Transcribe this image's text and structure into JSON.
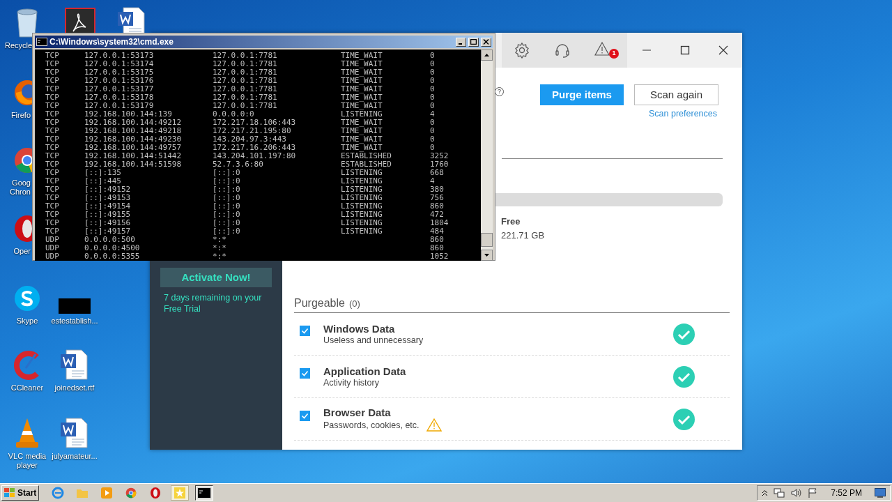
{
  "desktop_icons": [
    {
      "kind": "recycle",
      "label": "Recycle"
    },
    {
      "kind": "firefox",
      "label": "Firefo"
    },
    {
      "kind": "chrome",
      "label": "Goog\nChron"
    },
    {
      "kind": "opera",
      "label": "Oper"
    },
    {
      "kind": "skype",
      "label": "Skype"
    },
    {
      "kind": "ccleaner",
      "label": "CCleaner"
    },
    {
      "kind": "vlc",
      "label": "VLC media player"
    },
    {
      "kind": "pdf"
    },
    {
      "kind": "word"
    },
    {
      "kind": "blank",
      "label": "estestablish..."
    },
    {
      "kind": "word",
      "label": "joinedset.rtf"
    },
    {
      "kind": "word",
      "label": "julyamateur..."
    }
  ],
  "app": {
    "notification_count": "1",
    "help": "?",
    "purge_button": "Purge items",
    "scan_button": "Scan again",
    "scan_link": "Scan preferences",
    "free_label": "Free",
    "free_value": "221.71 GB",
    "activate_button": "Activate Now!",
    "trial_text": "7 days remaining on your Free Trial",
    "section_title": "Purgeable",
    "section_count": "(0)",
    "items": [
      {
        "title": "Windows Data",
        "subtitle": "Useless and unnecessary",
        "checked": true,
        "warning": false
      },
      {
        "title": "Application Data",
        "subtitle": "Activity history",
        "checked": true,
        "warning": false
      },
      {
        "title": "Browser Data",
        "subtitle": "Passwords, cookies, etc.",
        "checked": true,
        "warning": true
      }
    ]
  },
  "cmd": {
    "title": "C:\\Windows\\system32\\cmd.exe",
    "rows": [
      [
        "TCP",
        "127.0.0.1:53173",
        "127.0.0.1:7781",
        "TIME_WAIT",
        "0"
      ],
      [
        "TCP",
        "127.0.0.1:53174",
        "127.0.0.1:7781",
        "TIME_WAIT",
        "0"
      ],
      [
        "TCP",
        "127.0.0.1:53175",
        "127.0.0.1:7781",
        "TIME_WAIT",
        "0"
      ],
      [
        "TCP",
        "127.0.0.1:53176",
        "127.0.0.1:7781",
        "TIME_WAIT",
        "0"
      ],
      [
        "TCP",
        "127.0.0.1:53177",
        "127.0.0.1:7781",
        "TIME_WAIT",
        "0"
      ],
      [
        "TCP",
        "127.0.0.1:53178",
        "127.0.0.1:7781",
        "TIME_WAIT",
        "0"
      ],
      [
        "TCP",
        "127.0.0.1:53179",
        "127.0.0.1:7781",
        "TIME_WAIT",
        "0"
      ],
      [
        "TCP",
        "192.168.100.144:139",
        "0.0.0.0:0",
        "LISTENING",
        "4"
      ],
      [
        "TCP",
        "192.168.100.144:49212",
        "172.217.18.106:443",
        "TIME_WAIT",
        "0"
      ],
      [
        "TCP",
        "192.168.100.144:49218",
        "172.217.21.195:80",
        "TIME_WAIT",
        "0"
      ],
      [
        "TCP",
        "192.168.100.144:49230",
        "143.204.97.3:443",
        "TIME_WAIT",
        "0"
      ],
      [
        "TCP",
        "192.168.100.144:49757",
        "172.217.16.206:443",
        "TIME_WAIT",
        "0"
      ],
      [
        "TCP",
        "192.168.100.144:51442",
        "143.204.101.197:80",
        "ESTABLISHED",
        "3252"
      ],
      [
        "TCP",
        "192.168.100.144:51598",
        "52.7.3.6:80",
        "ESTABLISHED",
        "1760"
      ],
      [
        "TCP",
        "[::]:135",
        "[::]:0",
        "LISTENING",
        "668"
      ],
      [
        "TCP",
        "[::]:445",
        "[::]:0",
        "LISTENING",
        "4"
      ],
      [
        "TCP",
        "[::]:49152",
        "[::]:0",
        "LISTENING",
        "380"
      ],
      [
        "TCP",
        "[::]:49153",
        "[::]:0",
        "LISTENING",
        "756"
      ],
      [
        "TCP",
        "[::]:49154",
        "[::]:0",
        "LISTENING",
        "860"
      ],
      [
        "TCP",
        "[::]:49155",
        "[::]:0",
        "LISTENING",
        "472"
      ],
      [
        "TCP",
        "[::]:49156",
        "[::]:0",
        "LISTENING",
        "1804"
      ],
      [
        "TCP",
        "[::]:49157",
        "[::]:0",
        "LISTENING",
        "484"
      ],
      [
        "UDP",
        "0.0.0.0:500",
        "*:*",
        "",
        "860"
      ],
      [
        "UDP",
        "0.0.0.0:4500",
        "*:*",
        "",
        "860"
      ],
      [
        "UDP",
        "0.0.0.0:5355",
        "*:*",
        "",
        "1052"
      ]
    ]
  },
  "taskbar": {
    "start": "Start",
    "apps": [
      {
        "kind": "ie",
        "selected": false
      },
      {
        "kind": "folder",
        "selected": false
      },
      {
        "kind": "media",
        "selected": false
      },
      {
        "kind": "chrome",
        "selected": false
      },
      {
        "kind": "opera",
        "selected": false
      },
      {
        "kind": "sticky",
        "selected": false
      },
      {
        "kind": "cmd",
        "selected": true
      }
    ],
    "clock": "7:52 PM"
  }
}
